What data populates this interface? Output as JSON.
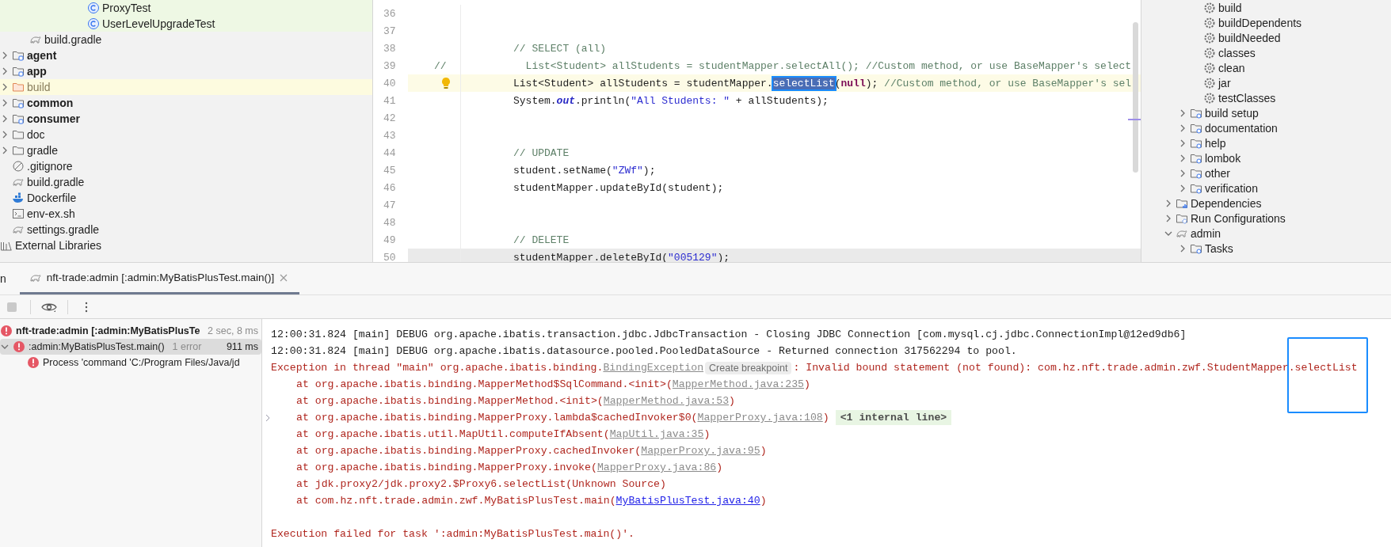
{
  "project_tree": {
    "nested_files": [
      {
        "label": "ProxyTest",
        "kind": "class"
      },
      {
        "label": "UserLevelUpgradeTest",
        "kind": "class"
      }
    ],
    "module_files": [
      {
        "label": "build.gradle",
        "kind": "gradle"
      }
    ],
    "root_items": [
      {
        "label": "agent",
        "kind": "module",
        "expanded": false
      },
      {
        "label": "app",
        "kind": "module",
        "expanded": false
      },
      {
        "label": "build",
        "kind": "excluded",
        "expanded": false
      },
      {
        "label": "common",
        "kind": "module",
        "expanded": false
      },
      {
        "label": "consumer",
        "kind": "module",
        "expanded": false
      },
      {
        "label": "doc",
        "kind": "folder",
        "expanded": false
      },
      {
        "label": "gradle",
        "kind": "folder",
        "expanded": false
      },
      {
        "label": ".gitignore",
        "kind": "ignore"
      },
      {
        "label": "build.gradle",
        "kind": "gradle"
      },
      {
        "label": "Dockerfile",
        "kind": "docker"
      },
      {
        "label": "env-ex.sh",
        "kind": "shell"
      },
      {
        "label": "settings.gradle",
        "kind": "gradle"
      }
    ],
    "external_libraries": "External Libraries"
  },
  "editor": {
    "lines": [
      {
        "number": "36"
      },
      {
        "number": "37"
      },
      {
        "number": "38",
        "segments": [
          {
            "kind": "comment",
            "text": "// SELECT (all)"
          }
        ]
      },
      {
        "number": "39",
        "gutter_text": "//",
        "segments": [
          {
            "kind": "comment",
            "text": "  List<Student> allStudents = studentMapper.selectAll(); //Custom method, or use BaseMapper's select"
          }
        ]
      },
      {
        "number": "40",
        "caret_line": true,
        "intention": true,
        "segments": [
          {
            "kind": "plain",
            "text": "List<Student> allStudents = studentMapper."
          },
          {
            "kind": "selected",
            "text": "selectList"
          },
          {
            "kind": "plain",
            "text": "("
          },
          {
            "kind": "keyword",
            "text": "null"
          },
          {
            "kind": "plain",
            "text": "); "
          },
          {
            "kind": "comment",
            "text": "//Custom method, or use BaseMapper's sel"
          }
        ]
      },
      {
        "number": "41",
        "segments": [
          {
            "kind": "plain",
            "text": "System."
          },
          {
            "kind": "field",
            "text": "out"
          },
          {
            "kind": "plain",
            "text": ".println("
          },
          {
            "kind": "string",
            "text": "\"All Students: \""
          },
          {
            "kind": "plain",
            "text": " + allStudents);"
          }
        ]
      },
      {
        "number": "42"
      },
      {
        "number": "43"
      },
      {
        "number": "44",
        "segments": [
          {
            "kind": "comment",
            "text": "// UPDATE"
          }
        ]
      },
      {
        "number": "45",
        "segments": [
          {
            "kind": "plain",
            "text": "student.setName("
          },
          {
            "kind": "string",
            "text": "\"ZWf\""
          },
          {
            "kind": "plain",
            "text": ");"
          }
        ]
      },
      {
        "number": "46",
        "segments": [
          {
            "kind": "plain",
            "text": "studentMapper.updateById(student);"
          }
        ]
      },
      {
        "number": "47"
      },
      {
        "number": "48"
      },
      {
        "number": "49",
        "segments": [
          {
            "kind": "comment",
            "text": "// DELETE"
          }
        ]
      },
      {
        "number": "50",
        "shaded": true,
        "segments": [
          {
            "kind": "plain",
            "text": "studentMapper.deleteById("
          },
          {
            "kind": "string",
            "text": "\"005129\""
          },
          {
            "kind": "plain",
            "text": ");"
          }
        ]
      }
    ]
  },
  "gradle_panel": {
    "tasks": [
      {
        "label": "build"
      },
      {
        "label": "buildDependents"
      },
      {
        "label": "buildNeeded"
      },
      {
        "label": "classes"
      },
      {
        "label": "clean"
      },
      {
        "label": "jar"
      },
      {
        "label": "testClasses"
      }
    ],
    "task_groups": [
      {
        "label": "build setup",
        "expanded": false
      },
      {
        "label": "documentation",
        "expanded": false
      },
      {
        "label": "help",
        "expanded": false
      },
      {
        "label": "lombok",
        "expanded": false
      },
      {
        "label": "other",
        "expanded": false
      },
      {
        "label": "verification",
        "expanded": false
      }
    ],
    "nodes": [
      {
        "label": "Dependencies",
        "kind": "dependencies",
        "expanded": false
      },
      {
        "label": "Run Configurations",
        "kind": "run-configs",
        "expanded": false
      },
      {
        "label": "admin",
        "kind": "project",
        "expanded": true,
        "children": [
          {
            "label": "Tasks",
            "kind": "tasks",
            "expanded": false
          }
        ]
      }
    ]
  },
  "run_window": {
    "title": "n",
    "tabs": [
      {
        "label": "nft-trade:admin [:admin:MyBatisPlusTest.main()]",
        "selected": true
      }
    ],
    "tree": [
      {
        "label": "nft-trade:admin [:admin:MyBatisPlusTe",
        "duration": "2 sec, 8 ms",
        "error": true,
        "selected": false,
        "children": [
          {
            "label": ":admin:MyBatisPlusTest.main()",
            "note": "1 error",
            "duration": "911 ms",
            "error": true,
            "selected": true,
            "expanded": true,
            "children": [
              {
                "label": "Process 'command 'C:/Program Files/Java/jd",
                "error": true,
                "selected": false
              }
            ]
          }
        ]
      }
    ],
    "console": {
      "highlight_frame": true,
      "lines": [
        {
          "kind": "log",
          "segments": [
            {
              "kind": "plain",
              "text": "12:00:31.824 [main] DEBUG org.apache.ibatis.transaction.jdbc.JdbcTransaction - Closing JDBC Connection [com.mysql.cj.jdbc.ConnectionImpl@12ed9db6]"
            }
          ]
        },
        {
          "kind": "log",
          "segments": [
            {
              "kind": "plain",
              "text": "12:00:31.824 [main] DEBUG org.apache.ibatis.datasource.pooled.PooledDataSource - Returned connection 317562294 to pool."
            }
          ]
        },
        {
          "kind": "log",
          "segments": [
            {
              "kind": "error",
              "text": "Exception in thread \"main\" org.apache.ibatis.binding."
            },
            {
              "kind": "link",
              "text": "BindingException"
            },
            {
              "kind": "chip",
              "text": "Create breakpoint"
            },
            {
              "kind": "error",
              "text": ": Invalid bound statement (not found): com.hz.nft.trade.admin.zwf.StudentMapper.selectList"
            }
          ]
        },
        {
          "kind": "stack",
          "segments": [
            {
              "kind": "error",
              "text": "at org.apache.ibatis.binding.MapperMethod$SqlCommand.<init>("
            },
            {
              "kind": "link",
              "text": "MapperMethod.java:235"
            },
            {
              "kind": "error",
              "text": ")"
            }
          ]
        },
        {
          "kind": "stack",
          "segments": [
            {
              "kind": "error",
              "text": "at org.apache.ibatis.binding.MapperMethod.<init>("
            },
            {
              "kind": "link",
              "text": "MapperMethod.java:53"
            },
            {
              "kind": "error",
              "text": ")"
            }
          ]
        },
        {
          "kind": "stack",
          "folded": true,
          "segments": [
            {
              "kind": "error",
              "text": "at org.apache.ibatis.binding.MapperProxy.lambda$cachedInvoker$0("
            },
            {
              "kind": "link",
              "text": "MapperProxy.java:108"
            },
            {
              "kind": "error",
              "text": ")"
            },
            {
              "kind": "internal",
              "text": "<1 internal line>"
            }
          ]
        },
        {
          "kind": "stack",
          "segments": [
            {
              "kind": "error",
              "text": "at org.apache.ibatis.util.MapUtil.computeIfAbsent("
            },
            {
              "kind": "link",
              "text": "MapUtil.java:35"
            },
            {
              "kind": "error",
              "text": ")"
            }
          ]
        },
        {
          "kind": "stack",
          "segments": [
            {
              "kind": "error",
              "text": "at org.apache.ibatis.binding.MapperProxy.cachedInvoker("
            },
            {
              "kind": "link",
              "text": "MapperProxy.java:95"
            },
            {
              "kind": "error",
              "text": ")"
            }
          ]
        },
        {
          "kind": "stack",
          "segments": [
            {
              "kind": "error",
              "text": "at org.apache.ibatis.binding.MapperProxy.invoke("
            },
            {
              "kind": "link",
              "text": "MapperProxy.java:86"
            },
            {
              "kind": "error",
              "text": ")"
            }
          ]
        },
        {
          "kind": "stack",
          "segments": [
            {
              "kind": "error",
              "text": "at jdk.proxy2/jdk.proxy2.$Proxy6.selectList(Unknown Source)"
            }
          ]
        },
        {
          "kind": "stack",
          "segments": [
            {
              "kind": "error",
              "text": "at com.hz.nft.trade.admin.zwf.MyBatisPlusTest.main("
            },
            {
              "kind": "active-link",
              "text": "MyBatisPlusTest.java:40"
            },
            {
              "kind": "error",
              "text": ")"
            }
          ]
        },
        {
          "kind": "blank"
        },
        {
          "kind": "log",
          "segments": [
            {
              "kind": "error",
              "text": "Execution failed for task ':admin:MyBatisPlusTest.main()'."
            }
          ]
        }
      ]
    }
  }
}
